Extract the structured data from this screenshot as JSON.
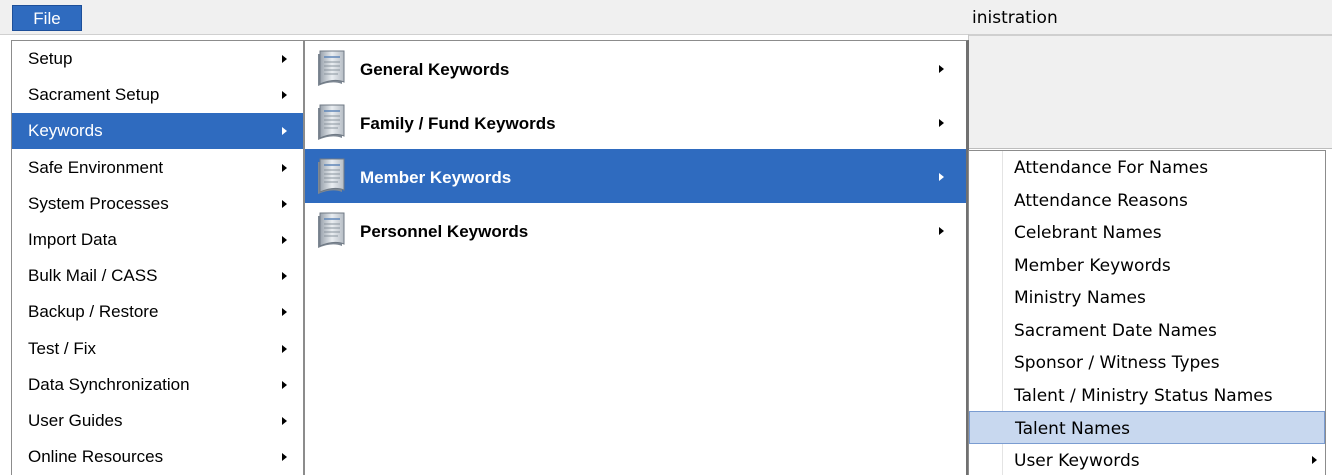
{
  "menubar": {
    "file_label": "File",
    "window_title_fragment": "inistration"
  },
  "main_menu": {
    "items": [
      {
        "label": "Setup",
        "submenu": true
      },
      {
        "label": "Sacrament Setup",
        "submenu": true
      },
      {
        "label": "Keywords",
        "submenu": true,
        "active": true
      },
      {
        "label": "Safe Environment",
        "submenu": true
      },
      {
        "label": "System Processes",
        "submenu": true
      },
      {
        "label": "Import Data",
        "submenu": true
      },
      {
        "label": "Bulk Mail / CASS",
        "submenu": true
      },
      {
        "label": "Backup / Restore",
        "submenu": true
      },
      {
        "label": "Test / Fix",
        "submenu": true
      },
      {
        "label": "Data Synchronization",
        "submenu": true
      },
      {
        "label": "User Guides",
        "submenu": true
      },
      {
        "label": "Online Resources",
        "submenu": true
      }
    ]
  },
  "keywords_menu": {
    "items": [
      {
        "label": "General Keywords",
        "icon": "document-icon",
        "submenu": true
      },
      {
        "label": "Family / Fund Keywords",
        "icon": "document-icon",
        "submenu": true
      },
      {
        "label": "Member Keywords",
        "icon": "document-icon",
        "submenu": true,
        "active": true
      },
      {
        "label": "Personnel Keywords",
        "icon": "document-icon",
        "submenu": true
      }
    ]
  },
  "member_keywords_menu": {
    "items": [
      {
        "label": "Attendance For Names"
      },
      {
        "label": "Attendance Reasons"
      },
      {
        "label": "Celebrant Names"
      },
      {
        "label": "Member Keywords"
      },
      {
        "label": "Ministry Names"
      },
      {
        "label": "Sacrament Date Names"
      },
      {
        "label": "Sponsor / Witness Types"
      },
      {
        "label": "Talent / Ministry Status Names"
      },
      {
        "label": "Talent Names",
        "hover": true
      },
      {
        "label": "User Keywords",
        "submenu": true
      }
    ]
  },
  "colors": {
    "accent": "#2f6bbf",
    "hover": "#c8d8ef"
  }
}
